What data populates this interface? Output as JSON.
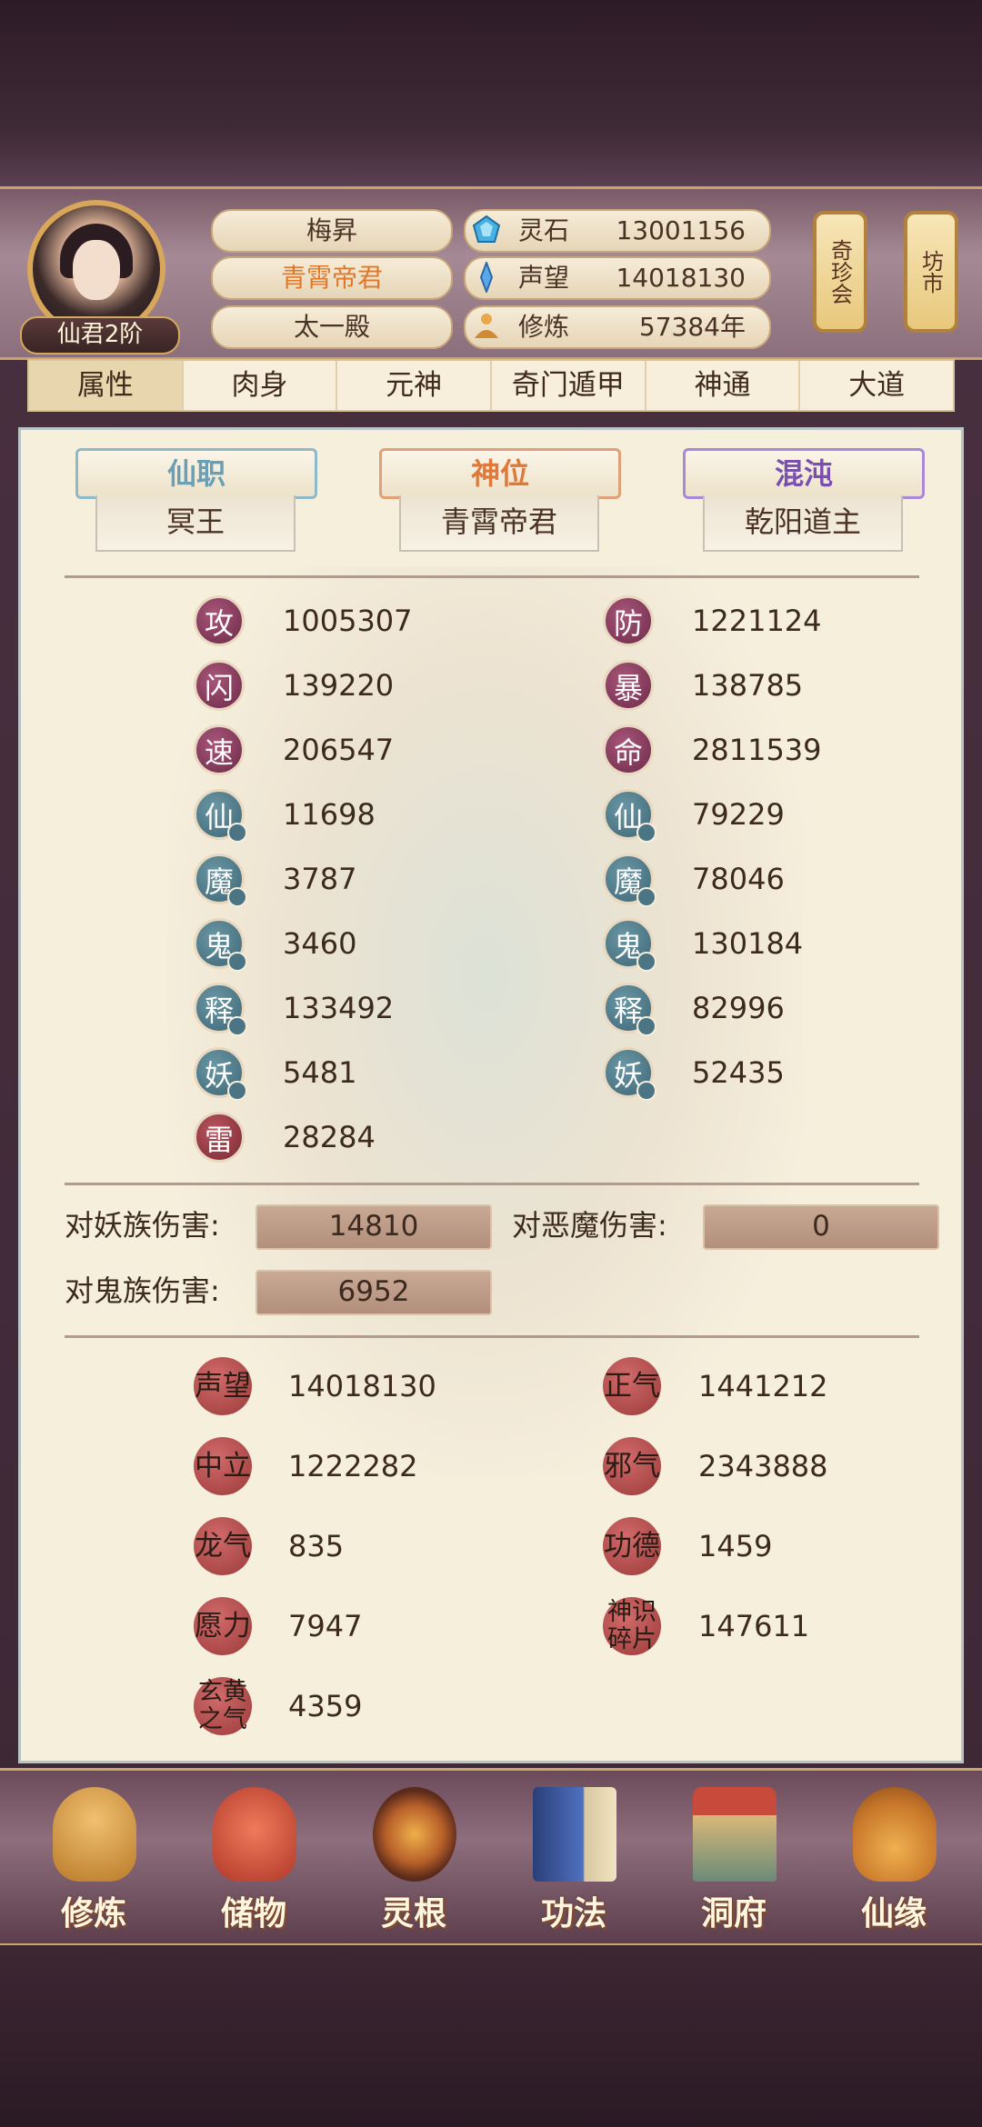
{
  "player": {
    "name": "梅昇",
    "title": "青霄帝君",
    "hall": "太一殿",
    "rank": "仙君2阶"
  },
  "resources": [
    {
      "label": "灵石",
      "value": "13001156",
      "icon": "spirit-stone-icon"
    },
    {
      "label": "声望",
      "value": "14018130",
      "icon": "prestige-crystal-icon"
    },
    {
      "label": "修炼",
      "value": "57384年",
      "icon": "meditation-icon"
    }
  ],
  "side_buttons": {
    "treasure": "奇珍会",
    "market": "坊市"
  },
  "tabs": [
    "属性",
    "肉身",
    "元神",
    "奇门遁甲",
    "神通",
    "大道"
  ],
  "active_tab": "属性",
  "banners": [
    {
      "title": "仙职",
      "value": "冥王",
      "color": "#6a9fb8"
    },
    {
      "title": "神位",
      "value": "青霄帝君",
      "color": "#e0783a"
    },
    {
      "title": "混沌",
      "value": "乾阳道主",
      "color": "#7a4fb0"
    }
  ],
  "stats_left": [
    {
      "glyph": "攻",
      "value": "1005307",
      "style": "purple"
    },
    {
      "glyph": "闪",
      "value": "139220",
      "style": "purple"
    },
    {
      "glyph": "速",
      "value": "206547",
      "style": "purple"
    },
    {
      "glyph": "仙",
      "value": "11698",
      "style": "teal"
    },
    {
      "glyph": "魔",
      "value": "3787",
      "style": "teal"
    },
    {
      "glyph": "鬼",
      "value": "3460",
      "style": "teal"
    },
    {
      "glyph": "释",
      "value": "133492",
      "style": "teal"
    },
    {
      "glyph": "妖",
      "value": "5481",
      "style": "teal"
    },
    {
      "glyph": "雷",
      "value": "28284",
      "style": "red"
    }
  ],
  "stats_right": [
    {
      "glyph": "防",
      "value": "1221124",
      "style": "purple"
    },
    {
      "glyph": "暴",
      "value": "138785",
      "style": "purple"
    },
    {
      "glyph": "命",
      "value": "2811539",
      "style": "purple"
    },
    {
      "glyph": "仙",
      "value": "79229",
      "style": "teal"
    },
    {
      "glyph": "魔",
      "value": "78046",
      "style": "teal"
    },
    {
      "glyph": "鬼",
      "value": "130184",
      "style": "teal"
    },
    {
      "glyph": "释",
      "value": "82996",
      "style": "teal"
    },
    {
      "glyph": "妖",
      "value": "52435",
      "style": "teal"
    }
  ],
  "damage": [
    {
      "label": "对妖族伤害:",
      "value": "14810"
    },
    {
      "label": "对恶魔伤害:",
      "value": "0"
    },
    {
      "label": "对鬼族伤害:",
      "value": "6952"
    }
  ],
  "virtues_left": [
    {
      "glyph": "声望",
      "value": "14018130"
    },
    {
      "glyph": "中立",
      "value": "1222282"
    },
    {
      "glyph": "龙气",
      "value": "835"
    },
    {
      "glyph": "愿力",
      "value": "7947"
    },
    {
      "glyph": "玄黄之气",
      "value": "4359"
    }
  ],
  "virtues_right": [
    {
      "glyph": "正气",
      "value": "1441212"
    },
    {
      "glyph": "邪气",
      "value": "2343888"
    },
    {
      "glyph": "功德",
      "value": "1459"
    },
    {
      "glyph": "神识碎片",
      "value": "147611"
    }
  ],
  "nav": [
    {
      "label": "修炼",
      "icon": "cultivator-icon",
      "color": "#c98a3a"
    },
    {
      "label": "储物",
      "icon": "bag-icon",
      "color": "#d2523a"
    },
    {
      "label": "灵根",
      "icon": "spirit-root-icon",
      "color": "#b8602a"
    },
    {
      "label": "功法",
      "icon": "book-icon",
      "color": "#3f5fa8"
    },
    {
      "label": "洞府",
      "icon": "palace-icon",
      "color": "#a87a3a"
    },
    {
      "label": "仙缘",
      "icon": "gourd-icon",
      "color": "#d4903a"
    }
  ]
}
